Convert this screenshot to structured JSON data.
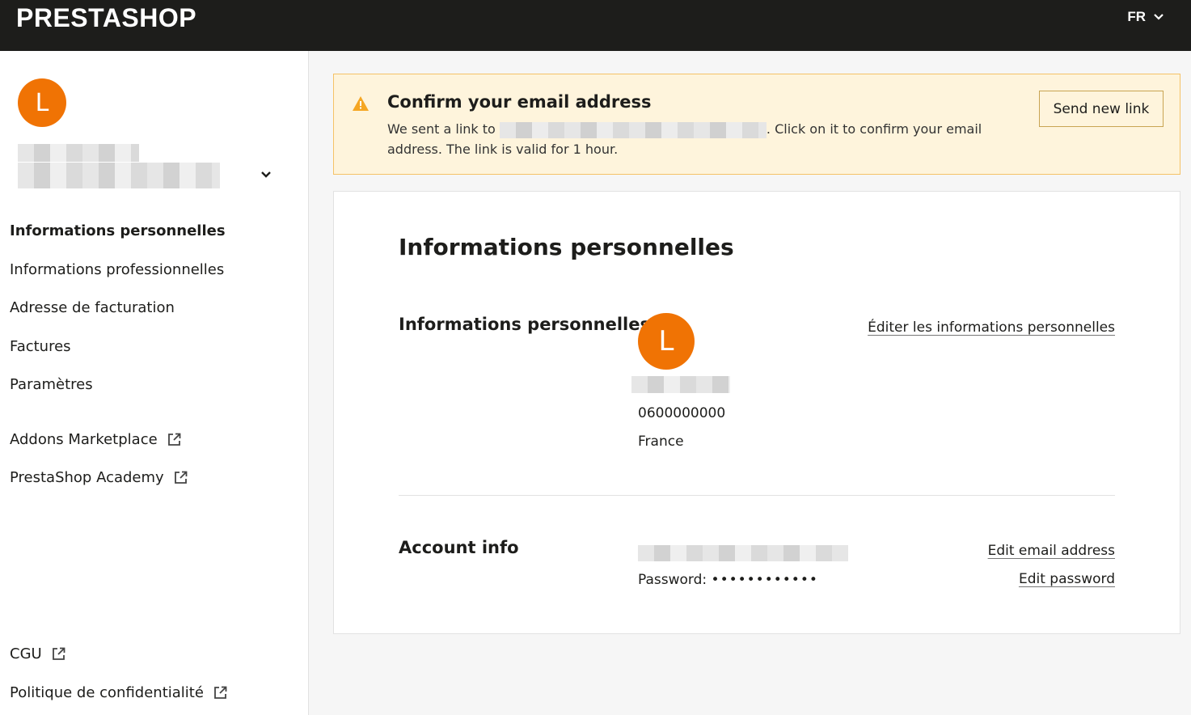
{
  "header": {
    "logo": "PRESTASHOP",
    "language": "FR"
  },
  "sidebar": {
    "avatar_initial": "L",
    "nav": [
      {
        "label": "Informations personnelles",
        "active": true
      },
      {
        "label": "Informations professionnelles"
      },
      {
        "label": "Adresse de facturation"
      },
      {
        "label": "Factures"
      },
      {
        "label": "Paramètres"
      }
    ],
    "external_links": [
      {
        "label": "Addons Marketplace"
      },
      {
        "label": "PrestaShop Academy"
      }
    ],
    "footer_links": [
      {
        "label": "CGU"
      },
      {
        "label": "Politique de confidentialité"
      }
    ]
  },
  "alert": {
    "title": "Confirm your email address",
    "text_before": "We sent a link to ",
    "text_after": ". Click on it to confirm your email address. The link is valid for 1 hour.",
    "button": "Send new link"
  },
  "main": {
    "page_title": "Informations personnelles",
    "personal": {
      "section_title": "Informations personnelles",
      "avatar_initial": "L",
      "phone": "0600000000",
      "country": "France",
      "edit_link": "Éditer les informations personnelles"
    },
    "account": {
      "section_title": "Account info",
      "password_label": "Password:",
      "password_mask": "••••••••••••",
      "edit_email": "Edit email address",
      "edit_password": "Edit password"
    }
  },
  "colors": {
    "header_bg": "#1d1d1b",
    "avatar": "#f07304",
    "alert_bg": "#fef4dc",
    "alert_border": "#f5c267",
    "warning": "#f5a623"
  }
}
